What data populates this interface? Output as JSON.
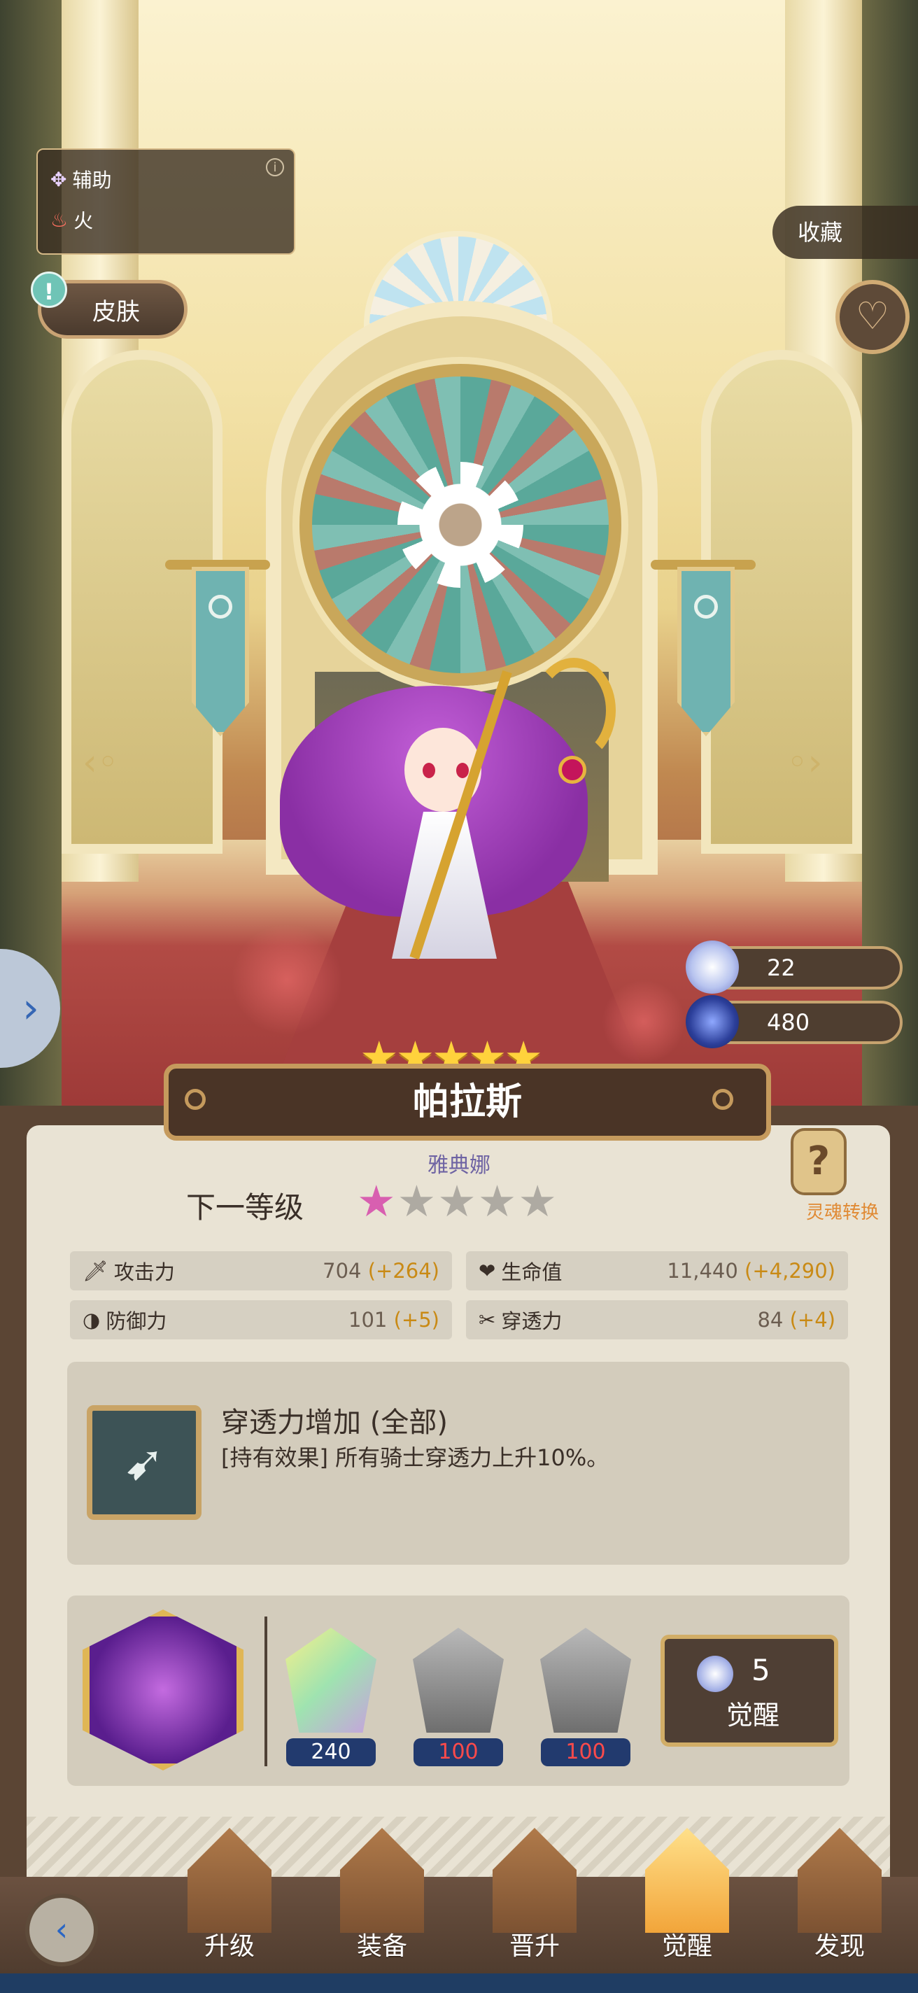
{
  "hero": {
    "role_label": "辅助",
    "element_label": "火",
    "name": "帕拉斯",
    "subname": "雅典娜",
    "star_count": 5
  },
  "top_controls": {
    "skin_label": "皮肤",
    "collect_label": "收藏"
  },
  "resources": [
    {
      "icon": "crystal-icon",
      "value": "22"
    },
    {
      "icon": "blue-gem-icon",
      "value": "480"
    }
  ],
  "next_level": {
    "label": "下一等级",
    "stars_total": 5,
    "stars_filled": 1
  },
  "soul_convert": {
    "label": "灵魂转换"
  },
  "stats": [
    {
      "label": "攻击力",
      "value": "704",
      "bonus": "(+264)",
      "icon": "sword-icon"
    },
    {
      "label": "生命值",
      "value": "11,440",
      "bonus": "(+4,290)",
      "icon": "heart-shield-icon"
    },
    {
      "label": "防御力",
      "value": "101",
      "bonus": "(+5)",
      "icon": "shield-icon"
    },
    {
      "label": "穿透力",
      "value": "84",
      "bonus": "(+4)",
      "icon": "pierce-icon"
    }
  ],
  "skill": {
    "title": "穿透力增加 (全部)",
    "description": "[持有效果] 所有骑士穿透力上升10%。"
  },
  "awaken_materials": [
    {
      "name": "hero-shard",
      "count": "240"
    },
    {
      "name": "fire-stone",
      "count": "100"
    },
    {
      "name": "fire-stone",
      "count": "100"
    }
  ],
  "awaken_button": {
    "cost": "5",
    "label": "觉醒"
  },
  "nav": {
    "items": [
      {
        "label": "升级",
        "active": false
      },
      {
        "label": "装备",
        "active": false
      },
      {
        "label": "晋升",
        "active": false
      },
      {
        "label": "觉醒",
        "active": true
      },
      {
        "label": "发现",
        "active": false
      }
    ]
  },
  "colors": {
    "bonus": "#c98a15",
    "panel": "#e9e3d4",
    "nav_bg": "#5b4534",
    "accent_gold": "#c59a5d",
    "count_text_red": "#ff4a4a"
  }
}
